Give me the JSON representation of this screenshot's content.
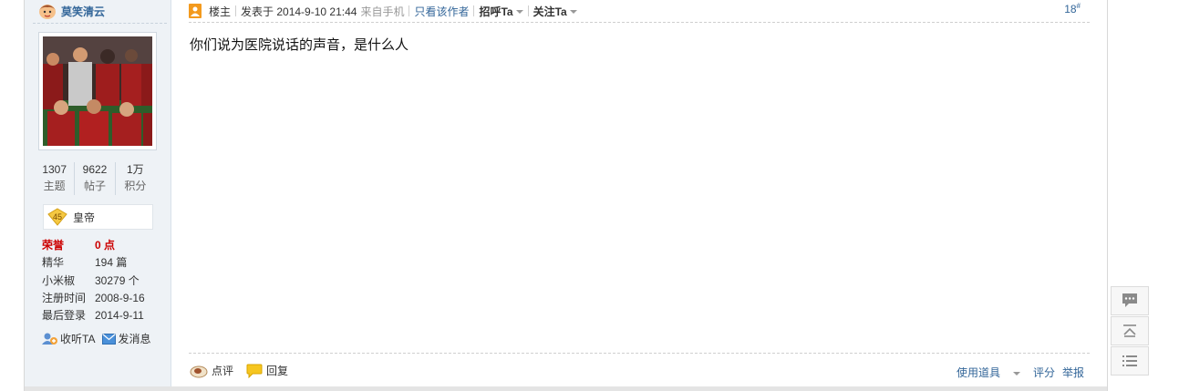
{
  "user": {
    "name": "莫笑清云",
    "stats": [
      {
        "value": "1307",
        "label": "主题"
      },
      {
        "value": "9622",
        "label": "帖子"
      },
      {
        "value": "1万",
        "label": "积分"
      }
    ],
    "rank": {
      "level": "45",
      "title": "皇帝"
    },
    "info": [
      {
        "key": "荣誉",
        "value": "0 点"
      },
      {
        "key": "精华",
        "value": "194 篇"
      },
      {
        "key": "小米椒",
        "value": "30279 个"
      },
      {
        "key": "注册时间",
        "value": "2008-9-16"
      },
      {
        "key": "最后登录",
        "value": "2014-9-11"
      }
    ],
    "actions": {
      "follow": "收听TA",
      "message": "发消息"
    }
  },
  "post": {
    "header": {
      "op_label": "楼主",
      "posted": "发表于 2014-9-10 21:44",
      "source": "来自手机",
      "only_author": "只看该作者",
      "greet": "招呼Ta",
      "follow": "关注Ta",
      "floor": "18",
      "floor_suffix": "#"
    },
    "content": "你们说为医院说话的声音，是什么人",
    "footer": {
      "comment": "点评",
      "reply": "回复",
      "use_tool": "使用道具",
      "rate": "评分",
      "report": "举报"
    }
  },
  "colors": {
    "link": "#336699",
    "highlight": "#cc0000",
    "sidebar_bg": "#eef2f6"
  }
}
